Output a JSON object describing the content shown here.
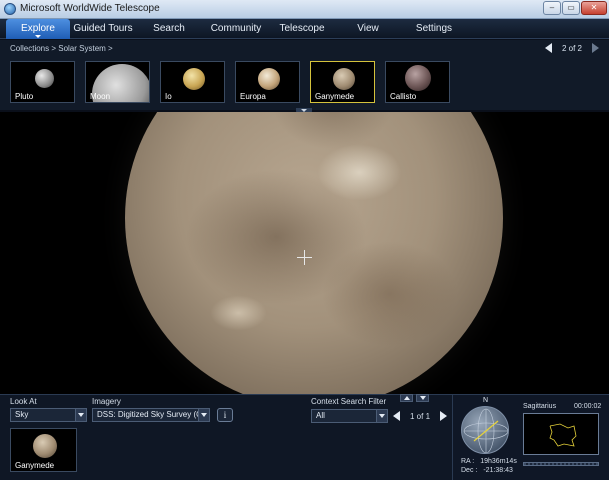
{
  "window": {
    "title": "Microsoft WorldWide Telescope",
    "controls": [
      "–",
      "▭",
      "✕"
    ]
  },
  "menu": {
    "items": [
      {
        "label": "Explore",
        "active": true
      },
      {
        "label": "Guided Tours",
        "active": false
      },
      {
        "label": "Search",
        "active": false
      },
      {
        "label": "Community",
        "active": false
      },
      {
        "label": "Telescope",
        "active": false
      },
      {
        "label": "View",
        "active": false
      },
      {
        "label": "Settings",
        "active": false
      }
    ]
  },
  "breadcrumb": {
    "text": "Collections  >  Solar System  >"
  },
  "collection_pager": {
    "text": "2 of 2"
  },
  "thumbnails": [
    {
      "label": "Pluto",
      "selected": false
    },
    {
      "label": "Moon",
      "selected": false
    },
    {
      "label": "Io",
      "selected": false
    },
    {
      "label": "Europa",
      "selected": false
    },
    {
      "label": "Ganymede",
      "selected": true
    },
    {
      "label": "Callisto",
      "selected": false
    }
  ],
  "bottom": {
    "look_at": {
      "label": "Look At",
      "value": "Sky"
    },
    "imagery": {
      "label": "Imagery",
      "value": "DSS: Digitized Sky Survey (O..."
    },
    "info_glyph": "i",
    "current_object": {
      "label": "Ganymede"
    },
    "context_search": {
      "label": "Context Search Filter",
      "value": "All",
      "pager": "1 of 1"
    }
  },
  "navigator": {
    "north": "N",
    "ra_label": "RA :",
    "ra_value": "19h36m14s",
    "dec_label": "Dec :",
    "dec_value": "-21:38:43",
    "constellation": "Sagittarius",
    "clock": "00:00:02"
  },
  "colors": {
    "accent": "#1f5db5",
    "selected_border": "#d4c23c",
    "background": "#0a0f1a"
  }
}
